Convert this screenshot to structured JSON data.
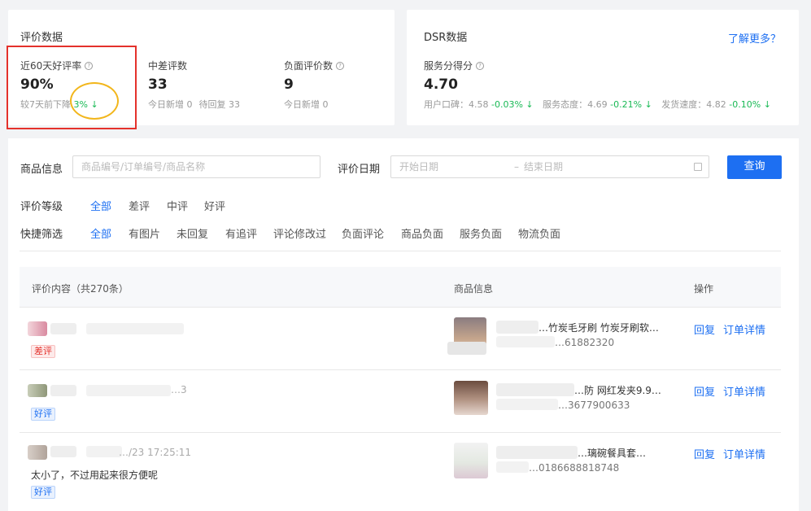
{
  "eval": {
    "title": "评价数据",
    "good_rate": {
      "label": "近60天好评率",
      "value": "90%",
      "sub_prefix": "较7天前下降",
      "sub_delta": "3%",
      "sub_arrow": "↓"
    },
    "mid_bad": {
      "label": "中差评数",
      "value": "33",
      "today_new": "今日新增 0",
      "pending": "待回复 33"
    },
    "negative": {
      "label": "负面评价数",
      "value": "9",
      "today_new": "今日新增 0"
    }
  },
  "dsr": {
    "title": "DSR数据",
    "more_link": "了解更多？",
    "score_label": "服务分得分",
    "score_value": "4.70",
    "word_of_mouth": {
      "label": "用户口碑：4.58",
      "delta": "-0.03%",
      "arrow": "↓"
    },
    "attitude": {
      "label": "服务态度：4.69",
      "delta": "-0.21%",
      "arrow": "↓"
    },
    "shipping": {
      "label": "发货速度：4.82",
      "delta": "-0.10%",
      "arrow": "↓"
    }
  },
  "filters": {
    "product_label": "商品信息",
    "product_placeholder": "商品编号/订单编号/商品名称",
    "date_label": "评价日期",
    "start_placeholder": "开始日期",
    "range_sep": "–",
    "end_placeholder": "结束日期",
    "query_button": "查询",
    "level_label": "评价等级",
    "levels": [
      "全部",
      "差评",
      "中评",
      "好评"
    ],
    "quick_label": "快捷筛选",
    "quick": [
      "全部",
      "有图片",
      "未回复",
      "有追评",
      "评论修改过",
      "负面评论",
      "商品负面",
      "服务负面",
      "物流负面"
    ]
  },
  "table": {
    "col_content": "评价内容（共270条）",
    "col_product": "商品信息",
    "col_action": "操作",
    "rows": [
      {
        "tag": "差评",
        "product_title": "…竹炭毛牙刷 竹炭牙刷软…",
        "product_id": "…61882320",
        "reply": "回复",
        "detail": "订单详情"
      },
      {
        "tag": "好评",
        "partial_time": "…3",
        "product_title": "…防 网红发夹9.9…",
        "product_id": "…3677900633",
        "reply": "回复",
        "detail": "订单详情"
      },
      {
        "tag": "好评",
        "time": "…/23 17:25:11",
        "content": "太小了，不过用起来很方便呢",
        "product_title": "…璃碗餐具套…",
        "product_id": "…0186688818748",
        "reply": "回复",
        "detail": "订单详情"
      }
    ]
  },
  "colors": {
    "accent": "#1d6ff2",
    "down": "#19b955",
    "highlight_box": "#e4312b",
    "highlight_oval": "#f2b61c"
  }
}
